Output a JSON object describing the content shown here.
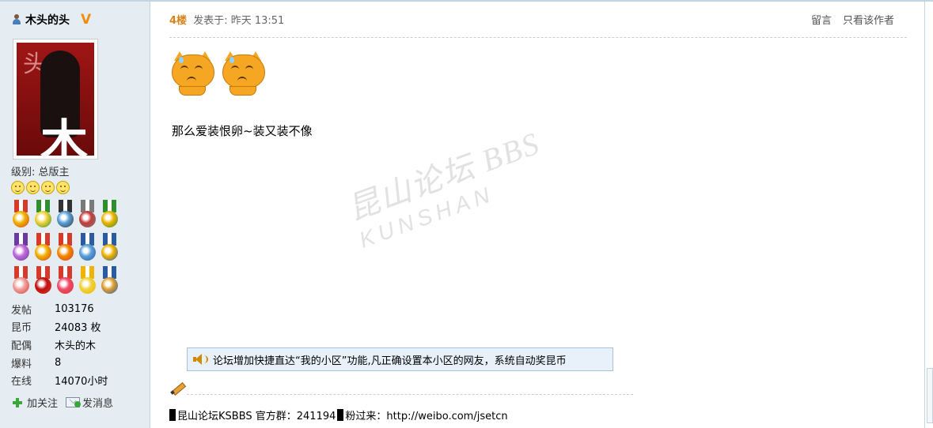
{
  "user": {
    "name": "木头的头",
    "vip_badge": "V",
    "level_label": "级别: 总版主"
  },
  "stats": [
    {
      "label": "发帖",
      "value": "103176"
    },
    {
      "label": "昆币",
      "value": "24083 枚"
    },
    {
      "label": "配偶",
      "value": "木头的木"
    },
    {
      "label": "爆料",
      "value": "8"
    },
    {
      "label": "在线",
      "value": "14070小时"
    }
  ],
  "actions": {
    "follow_label": "加关注",
    "message_label": "发消息"
  },
  "post": {
    "floor": "4楼",
    "posted_at": "发表于: 昨天  13:51",
    "reply_label": "留言",
    "only_author_label": "只看该作者",
    "message": "那么爱装恨卵~装又装不像",
    "notice": "论坛增加快捷直达“我的小区”功能,凡正确设置本小区的网友，系统自动奖昆币",
    "signature_part1": "昆山论坛KSBBS 官方群：241194",
    "signature_part2": "粉过来：http://weibo.com/jsetcn"
  },
  "watermark": {
    "main": "昆山论坛 BBS",
    "sub": "KUNSHAN"
  },
  "colors": {
    "sidebar_bg": "#e5edf2",
    "floor_accent": "#d7831a",
    "notice_bg": "#e8f1fa",
    "vip": "#f28c0f"
  },
  "medal_colors": [
    [
      "#d63a2a",
      "#f0b400"
    ],
    [
      "#2f8f2f",
      "#f0d23a"
    ],
    [
      "#333333",
      "#5aa0d8"
    ],
    [
      "#7a7a7a",
      "#c23a3a"
    ],
    [
      "#2f8f2f",
      "#f0b400"
    ],
    [
      "#6a3aa0",
      "#c06ad8"
    ],
    [
      "#d63a2a",
      "#f0b400"
    ],
    [
      "#d63a2a",
      "#f08a00"
    ],
    [
      "#2a5aa0",
      "#5aa0d8"
    ],
    [
      "#2a5aa0",
      "#f0b400"
    ],
    [
      "#d63a2a",
      "#f0a0a0"
    ],
    [
      "#d63a2a",
      "#c01010"
    ],
    [
      "#d63a2a",
      "#f04a6a"
    ],
    [
      "#f0b400",
      "#f0d23a"
    ],
    [
      "#2a5aa0",
      "#e0a030"
    ]
  ]
}
